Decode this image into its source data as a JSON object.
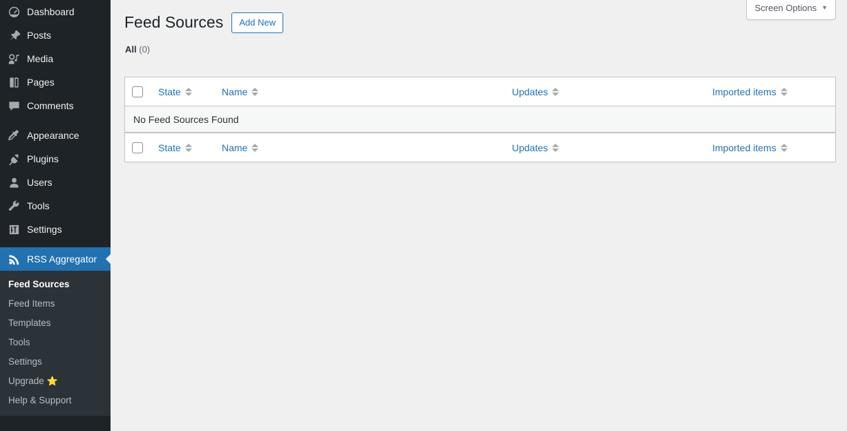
{
  "sidebar": {
    "items": [
      {
        "label": "Dashboard",
        "icon": "dashboard-icon"
      },
      {
        "label": "Posts",
        "icon": "pin-icon"
      },
      {
        "label": "Media",
        "icon": "media-icon"
      },
      {
        "label": "Pages",
        "icon": "pages-icon"
      },
      {
        "label": "Comments",
        "icon": "comments-icon"
      },
      {
        "label": "Appearance",
        "icon": "appearance-icon"
      },
      {
        "label": "Plugins",
        "icon": "plugins-icon"
      },
      {
        "label": "Users",
        "icon": "users-icon"
      },
      {
        "label": "Tools",
        "icon": "tools-icon"
      },
      {
        "label": "Settings",
        "icon": "settings-icon"
      },
      {
        "label": "RSS Aggregator",
        "icon": "rss-icon"
      }
    ],
    "submenu": [
      {
        "label": "Feed Sources",
        "current": true
      },
      {
        "label": "Feed Items",
        "current": false
      },
      {
        "label": "Templates",
        "current": false
      },
      {
        "label": "Tools",
        "current": false
      },
      {
        "label": "Settings",
        "current": false
      },
      {
        "label": "Upgrade",
        "current": false,
        "badge": "⭐"
      },
      {
        "label": "Help & Support",
        "current": false
      }
    ]
  },
  "screen_meta": {
    "screen_options_label": "Screen Options",
    "caret": "▼"
  },
  "page": {
    "title": "Feed Sources",
    "add_new_label": "Add New"
  },
  "filters": {
    "all_label": "All",
    "all_count": "(0)"
  },
  "table": {
    "columns": {
      "state": "State",
      "name": "Name",
      "updates": "Updates",
      "imported": "Imported items"
    },
    "empty_message": "No Feed Sources Found"
  },
  "colors": {
    "accent": "#2271b1",
    "sidebar_bg": "#1d2327",
    "submenu_bg": "#2c3338",
    "page_bg": "#f0f0f1",
    "star": "#ffb900"
  }
}
